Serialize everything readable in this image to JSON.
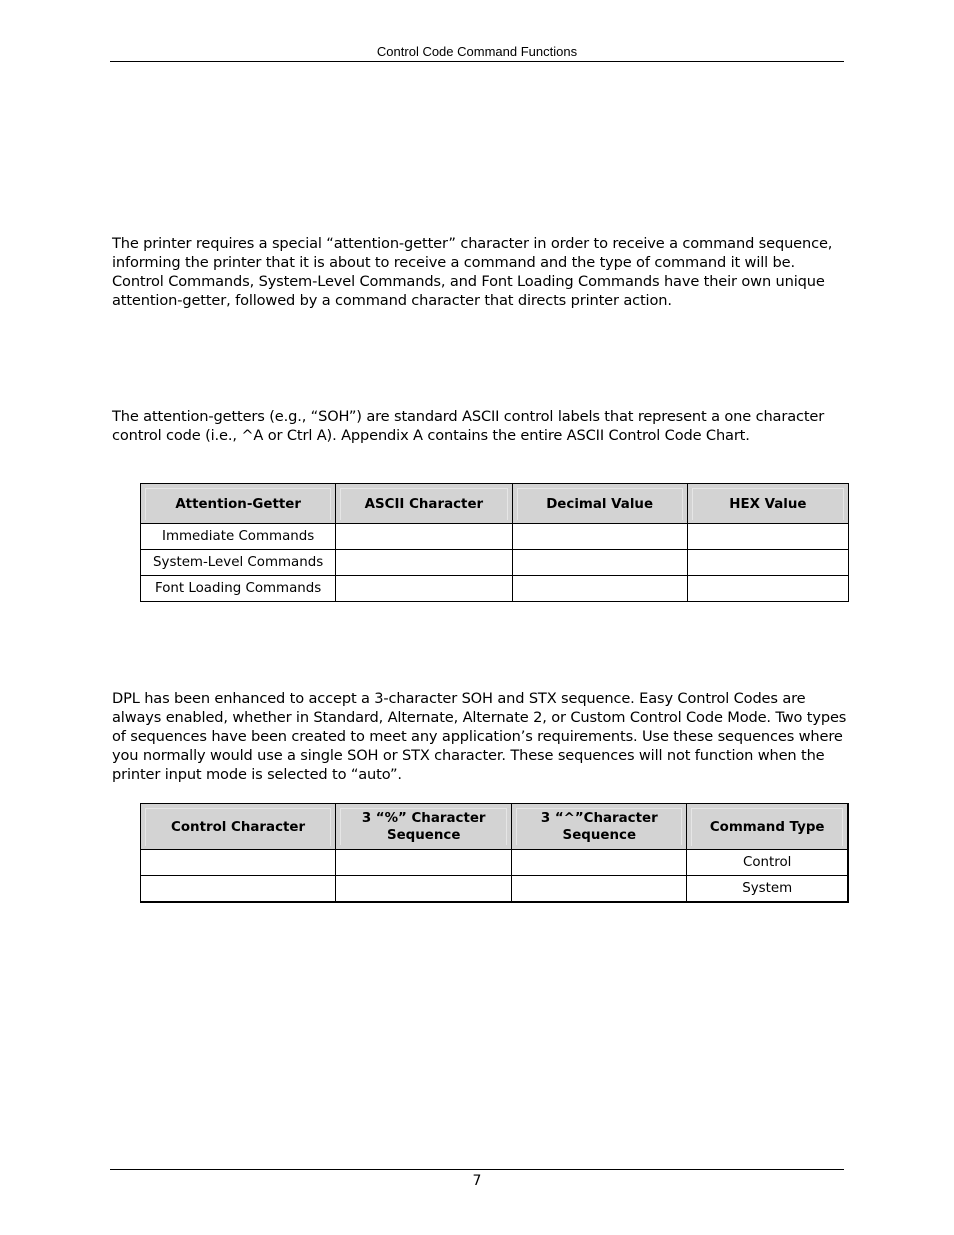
{
  "header": {
    "title": "Control Code Command Functions"
  },
  "paragraphs": [
    "The printer requires a special “attention-getter” character in order to receive a command sequence, informing the printer that it is about to receive a command and the type of command it will be. Control Commands, System-Level Commands, and Font Loading Commands have their own unique attention-getter, followed by a command character that directs printer action.",
    "The attention-getters (e.g., “SOH”) are standard ASCII control labels that represent a one character control code (i.e., ^A or Ctrl A). Appendix A contains the entire ASCII Control Code Chart.",
    "DPL has been enhanced to accept a 3-character SOH and STX sequence. Easy Control Codes are always enabled, whether in Standard, Alternate, Alternate 2, or Custom Control Code Mode. Two types of sequences have been created to meet any application’s requirements. Use these sequences where you normally would use a single SOH or STX character. These sequences will not function when the printer input mode is selected to “auto”."
  ],
  "attention_table": {
    "columns": [
      "Attention-Getter",
      "ASCII Character",
      "Decimal Value",
      "HEX Value"
    ],
    "rows": [
      [
        "Immediate Commands",
        "",
        "",
        ""
      ],
      [
        "System-Level Commands",
        "",
        "",
        ""
      ],
      [
        "Font Loading Commands",
        "",
        "",
        ""
      ]
    ]
  },
  "sequence_table": {
    "columns": [
      "Control Character",
      "3 “%” Character Sequence",
      "3 “^”Character Sequence",
      "Command Type"
    ],
    "rows": [
      [
        "",
        "",
        "",
        "Control"
      ],
      [
        "",
        "",
        "",
        "System"
      ]
    ]
  },
  "footer": {
    "page_number": "7"
  },
  "colors": {
    "table_header_bg": "#d3d3d3",
    "text": "#000000"
  }
}
